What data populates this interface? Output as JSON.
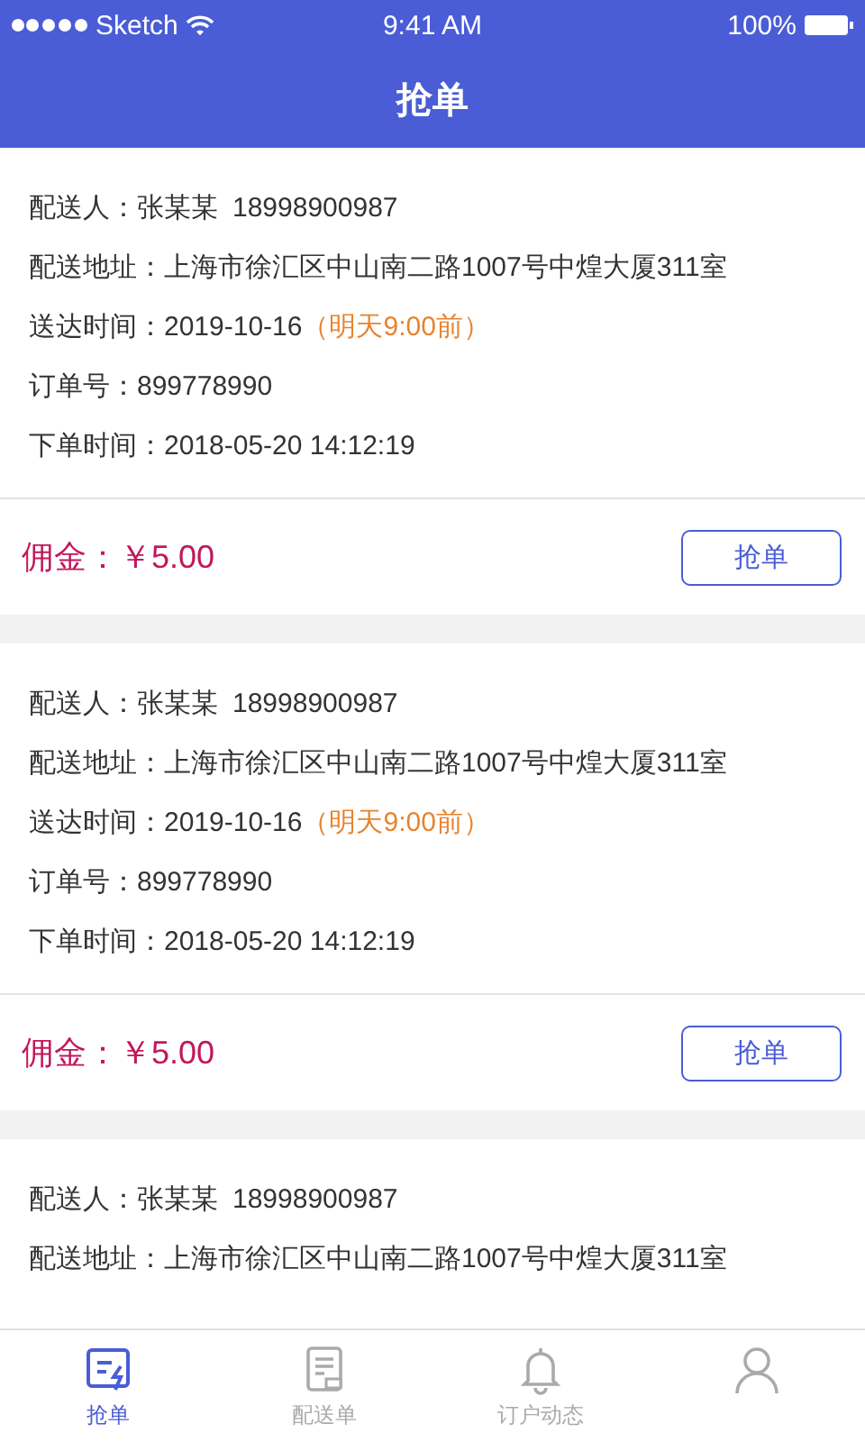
{
  "status_bar": {
    "carrier": "Sketch",
    "time": "9:41 AM",
    "battery": "100%"
  },
  "header": {
    "title": "抢单"
  },
  "orders": [
    {
      "rows": [
        {
          "label": "配送人：",
          "value": "张某某",
          "extra": "18998900987"
        },
        {
          "label": "配送地址：",
          "value": "上海市徐汇区中山南二路1007号中煌大厦311室"
        },
        {
          "label": "送达时间：",
          "value": "2019-10-16",
          "note": "（明天9:00前）"
        },
        {
          "label": "订单号：",
          "value": "899778990"
        },
        {
          "label": "下单时间：",
          "value": "2018-05-20 14:12:19"
        }
      ],
      "commission_label": "佣金：",
      "commission": "￥5.00",
      "button": "抢单"
    },
    {
      "rows": [
        {
          "label": "配送人：",
          "value": "张某某",
          "extra": "18998900987"
        },
        {
          "label": "配送地址：",
          "value": "上海市徐汇区中山南二路1007号中煌大厦311室"
        },
        {
          "label": "送达时间：",
          "value": "2019-10-16",
          "note": "（明天9:00前）"
        },
        {
          "label": "订单号：",
          "value": "899778990"
        },
        {
          "label": "下单时间：",
          "value": "2018-05-20 14:12:19"
        }
      ],
      "commission_label": "佣金：",
      "commission": "￥5.00",
      "button": "抢单"
    },
    {
      "rows": [
        {
          "label": "配送人：",
          "value": "张某某",
          "extra": "18998900987"
        },
        {
          "label": "配送地址：",
          "value": "上海市徐汇区中山南二路1007号中煌大厦311室"
        }
      ]
    }
  ],
  "tabs": [
    {
      "kind": "grab",
      "label": "抢单",
      "selected": true
    },
    {
      "kind": "document",
      "label": "配送单",
      "selected": false
    },
    {
      "kind": "bell",
      "label": "订户动态",
      "selected": false
    },
    {
      "kind": "person",
      "selected": false
    }
  ]
}
